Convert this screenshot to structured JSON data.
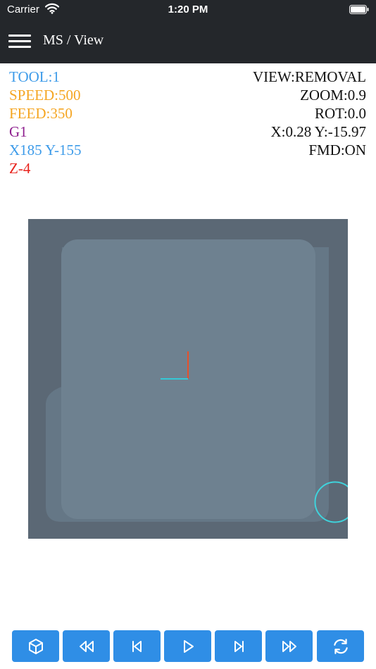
{
  "status_bar": {
    "carrier": "Carrier",
    "time": "1:20 PM"
  },
  "nav": {
    "title": "MS / View"
  },
  "info_left": [
    {
      "text": "TOOL:1",
      "color": "#3d9be9"
    },
    {
      "text": "SPEED:500",
      "color": "#f5a623"
    },
    {
      "text": "FEED:350",
      "color": "#f5a623"
    },
    {
      "text": "G1",
      "color": "#8e1f8e"
    },
    {
      "text": "X185 Y-155",
      "color": "#3d9be9"
    },
    {
      "text": "Z-4",
      "color": "#e8231c"
    }
  ],
  "info_right": {
    "view": "VIEW:REMOVAL",
    "zoom": "ZOOM:0.9",
    "rot": "ROT:0.0",
    "pos": "X:0.28 Y:-15.97",
    "fmd": "FMD:ON"
  },
  "colors": {
    "stock": "#5b6875",
    "removed": "#6e8190",
    "removed_outer": "#657786",
    "axis_x": "#35c8d6",
    "axis_y": "#e8502a",
    "tool": "#3fd3dc",
    "button": "#2f8ee6",
    "bar": "#24272b"
  },
  "toolbar": [
    {
      "name": "view-3d-button",
      "icon": "cube-icon"
    },
    {
      "name": "fast-rewind-button",
      "icon": "rewind-icon"
    },
    {
      "name": "step-back-button",
      "icon": "skip-back-icon"
    },
    {
      "name": "play-button",
      "icon": "play-icon"
    },
    {
      "name": "step-forward-button",
      "icon": "skip-forward-icon"
    },
    {
      "name": "fast-forward-button",
      "icon": "fast-forward-icon"
    },
    {
      "name": "reset-button",
      "icon": "refresh-icon"
    }
  ]
}
